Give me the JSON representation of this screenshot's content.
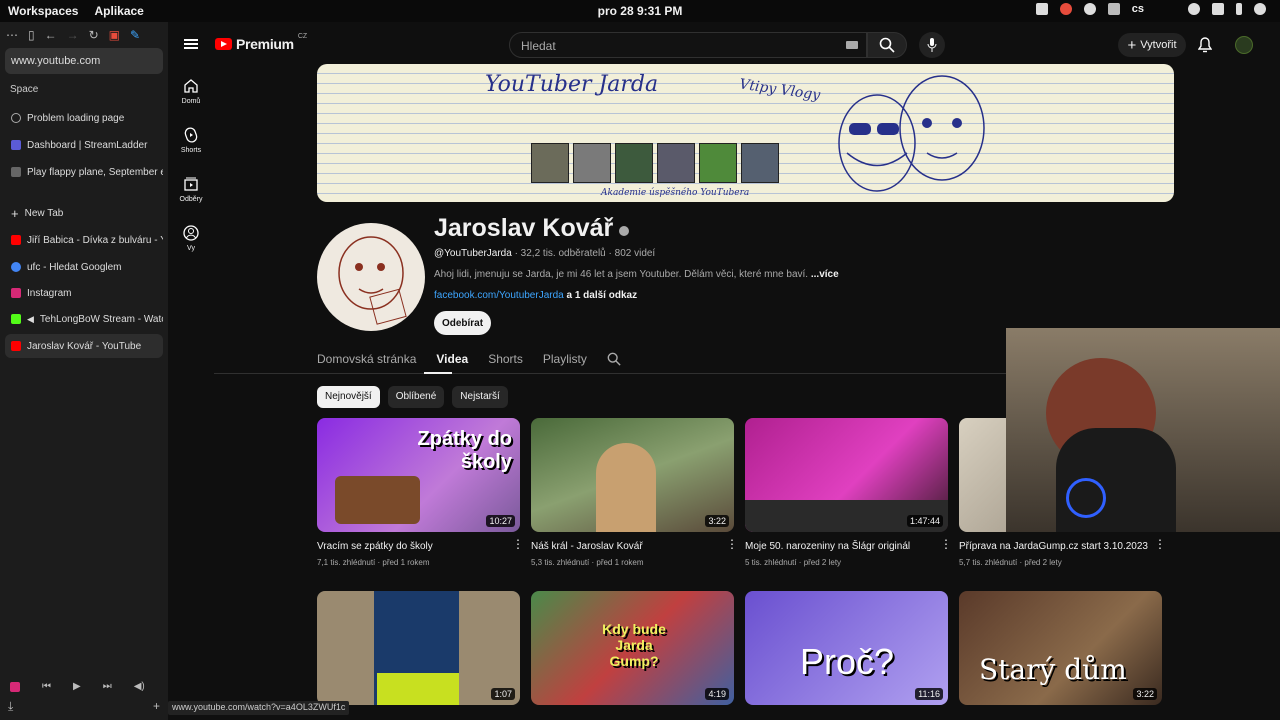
{
  "os": {
    "menu": [
      "Workspaces",
      "Aplikace"
    ],
    "clock": "pro 28  9:31 PM",
    "lang": "cs"
  },
  "browser": {
    "url": "www.youtube.com",
    "space_label": "Space",
    "pinned": [
      {
        "label": "Problem loading page",
        "color": "#888888"
      },
      {
        "label": "Dashboard | StreamLadder",
        "color": "#5b5bd6"
      },
      {
        "label": "Play flappy plane, September ed",
        "color": "#666666"
      }
    ],
    "new_tab": "New Tab",
    "tabs": [
      {
        "label": "Jiří Babica - Dívka z bulváru - Yo",
        "color": "#ff0000"
      },
      {
        "label": "ufc - Hledat Googlem",
        "color": "#4285f4"
      },
      {
        "label": "Instagram",
        "color": "#d62976"
      },
      {
        "label": "TehLongBoW Stream - Watch",
        "color": "#53fc18"
      },
      {
        "label": "Jaroslav Kovář - YouTube",
        "color": "#ff0000"
      }
    ],
    "status_url": "www.youtube.com/watch?v=a4OL3ZWUf1c"
  },
  "yt": {
    "logo_text": "Premium",
    "region": "CZ",
    "search_placeholder": "Hledat",
    "create_label": "Vytvořit",
    "nav": [
      {
        "label": "Domů",
        "icon": "home-icon"
      },
      {
        "label": "Shorts",
        "icon": "shorts-icon"
      },
      {
        "label": "Odběry",
        "icon": "subscriptions-icon"
      },
      {
        "label": "Vy",
        "icon": "you-icon"
      }
    ],
    "banner": {
      "title": "YouTuber Jarda",
      "subtitle": "Vtipy Vlogy",
      "footer": "Akademie úspěšného YouTubera"
    },
    "channel": {
      "name": "Jaroslav Kovář",
      "handle": "@YouTuberJarda",
      "stats": " · 32,2 tis. odběratelů · 802 videí",
      "desc": "Ahoj lidi, jmenuju se Jarda, je mi 46 let a jsem Youtuber. Dělám věci, které mne baví.",
      "more": "...více",
      "link": "facebook.com/YoutuberJarda",
      "link_more": " a 1 další odkaz",
      "subscribe": "Odebírat"
    },
    "tabs": [
      "Domovská stránka",
      "Videa",
      "Shorts",
      "Playlisty"
    ],
    "chips": [
      "Nejnovější",
      "Oblíbené",
      "Nejstarší"
    ],
    "videos": [
      {
        "title": "Vracím se zpátky do školy",
        "meta": "7,1 tis. zhlédnutí · před 1 rokem",
        "dur": "10:27",
        "thumb_text": "Zpátky do školy"
      },
      {
        "title": "Náš král - Jaroslav Kovář",
        "meta": "5,3 tis. zhlédnutí · před 1 rokem",
        "dur": "3:22",
        "thumb_text": ""
      },
      {
        "title": "Moje 50. narozeniny na Šlágr originál",
        "meta": "5 tis. zhlédnutí · před 2 lety",
        "dur": "1:47:44",
        "thumb_text": ""
      },
      {
        "title": "Příprava na JardaGump.cz start 3.10.2023",
        "meta": "5,7 tis. zhlédnutí · před 2 lety",
        "dur": "",
        "thumb_text": ""
      },
      {
        "title": "",
        "meta": "",
        "dur": "1:07",
        "thumb_text": ""
      },
      {
        "title": "",
        "meta": "",
        "dur": "4:19",
        "thumb_text": "Kdy bude Jarda Gump?"
      },
      {
        "title": "",
        "meta": "",
        "dur": "11:16",
        "thumb_text": "Proč?"
      },
      {
        "title": "",
        "meta": "",
        "dur": "3:22",
        "thumb_text": "Starý dům"
      }
    ]
  }
}
